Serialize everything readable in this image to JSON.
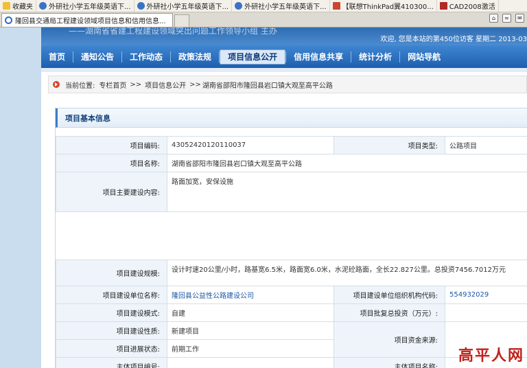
{
  "favorites": {
    "label": "收藏夹",
    "items": [
      "外研社小学五年级英语下...",
      "外研社小学五年级英语下...",
      "外研社小学五年级英语下...",
      "【联想ThinkPad翼410300...",
      "CAD2008激活"
    ]
  },
  "tab": {
    "title": "隆回县交通局工程建设领域项目信息和信用信息..."
  },
  "banner": {
    "slogan": "——湖南省省建工程建设领域突出问题工作领导小组 主办",
    "welcome": "欢迎, 您是本站的第450位访客 星期二 2013-03"
  },
  "nav": {
    "items": [
      "首页",
      "通知公告",
      "工作动态",
      "政策法规",
      "项目信息公开",
      "信用信息共享",
      "统计分析",
      "网站导航"
    ],
    "active_index": 4
  },
  "breadcrumb": {
    "prefix": "当前位置:",
    "home": "专栏首页",
    "sep": ">>",
    "section": "项目信息公开",
    "current": "湖南省邵阳市隆回县岩口镇大观至高平公路"
  },
  "panel": {
    "title": "项目基本信息"
  },
  "info": {
    "code_label": "项目编码:",
    "code": "43052420120110037",
    "type_label": "项目类型:",
    "type": "公路项目",
    "name_label": "项目名称:",
    "name": "湖南省邵阳市隆回县岩口镇大观至高平公路",
    "content_label": "项目主要建设内容:",
    "content": "路面加宽，安保设施",
    "scale_label": "项目建设规模:",
    "scale": "设计时速20公里/小时，路基宽6.5米，路面宽6.0米，水泥砼路面，全长22.827公里。总投资7456.7012万元",
    "unit_label": "项目建设单位名称:",
    "unit": "隆回县公益性公路建设公司",
    "orgcode_label": "项目建设单位组织机构代码:",
    "orgcode": "554932029",
    "mode_label": "项目建设模式:",
    "mode": "自建",
    "invest_label": "项目批复总投资（万元）:",
    "invest": "",
    "nature_label": "项目建设性质:",
    "nature": "新建项目",
    "fund_label": "项目资金来源:",
    "fund": "",
    "progress_label": "项目进展状态:",
    "progress": "前期工作",
    "mainno_label": "主体项目编号:",
    "mainno": "",
    "mainname_label": "主体项目名称:",
    "mainname": ""
  },
  "watermark": "高平人网",
  "colors": {
    "nav": "#2468b7",
    "label_bg": "#eef4fa",
    "link": "#1a56a3",
    "watermark": "#c0221c"
  }
}
